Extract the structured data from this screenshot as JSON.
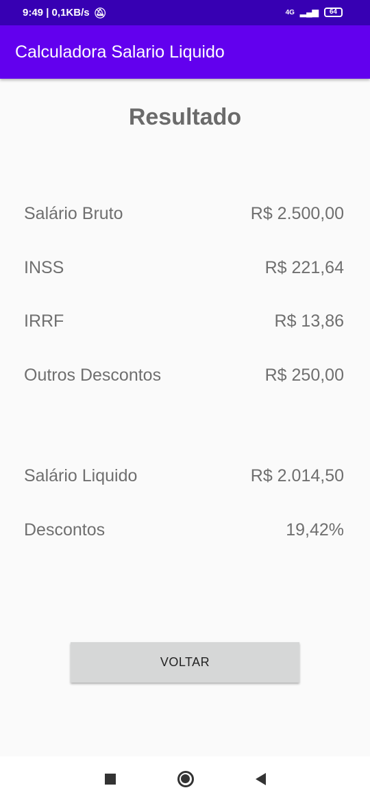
{
  "status_bar": {
    "time": "9:49 | 0,1KB/s",
    "network": "4G",
    "battery": "64"
  },
  "app_bar": {
    "title": "Calculadora Salario Liquido"
  },
  "main": {
    "title": "Resultado",
    "rows": [
      {
        "label": "Salário Bruto",
        "value": "R$ 2.500,00"
      },
      {
        "label": "INSS",
        "value": "R$ 221,64"
      },
      {
        "label": "IRRF",
        "value": "R$ 13,86"
      },
      {
        "label": "Outros Descontos",
        "value": "R$ 250,00"
      },
      {
        "label": "Salário Liquido",
        "value": "R$ 2.014,50"
      },
      {
        "label": "Descontos",
        "value": "19,42%"
      }
    ],
    "back_button": "VOLTAR"
  },
  "colors": {
    "status_bar": "#3700b3",
    "app_bar": "#6200ee"
  }
}
